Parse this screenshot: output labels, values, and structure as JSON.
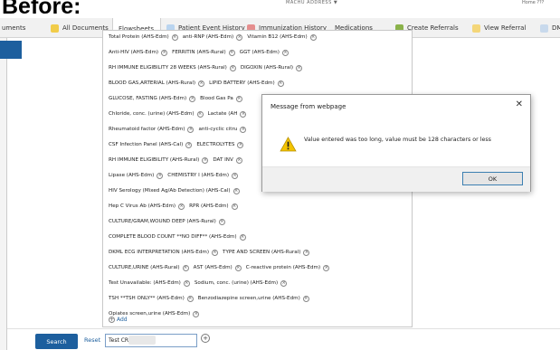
{
  "header": {
    "label": "Before:"
  },
  "topbar": {
    "center_fragment": "MACHU ADDRESS ▼",
    "right_fragment": "Home  ???"
  },
  "tabs": [
    {
      "label": "uments",
      "icon": "none"
    },
    {
      "label": "All Documents",
      "icon": "documents-icon"
    },
    {
      "label": "Flowsheets",
      "icon": "none"
    },
    {
      "label": "Patient Event History",
      "icon": "history-icon"
    },
    {
      "label": "Immunization History",
      "icon": "syringe-icon"
    },
    {
      "label": "Medications",
      "icon": "none"
    },
    {
      "label": "Create Referrals",
      "icon": "referral-icon"
    },
    {
      "label": "View Referral",
      "icon": "view-icon"
    },
    {
      "label": "DM",
      "icon": "dm-icon"
    }
  ],
  "orders": [
    [
      "Total Protein (AHS-Edm)",
      "anti-RNP (AHS-Edm)",
      "Vitamin B12 (AHS-Edm)"
    ],
    [
      "Anti-HIV (AHS-Edm)",
      "FERRITIN (AHS-Rural)",
      "GGT (AHS-Edm)"
    ],
    [
      "RH IMMUNE ELIGIBILITY 28 WEEKS (AHS-Rural)",
      "DIGOXIN (AHS-Rural)"
    ],
    [
      "BLOOD GAS,ARTERIAL (AHS-Rural)",
      "LIPID BATTERY (AHS-Edm)"
    ],
    [
      "GLUCOSE, FASTING (AHS-Edm)",
      "Blood Gas Pa"
    ],
    [
      "Chloride, conc. (urine) (AHS-Edm)",
      "Lactate (AH"
    ],
    [
      "Rheumatoid factor (AHS-Edm)",
      "anti-cyclic citru"
    ],
    [
      "CSF Infection Panel (AHS-Cal)",
      "ELECTROLYTES"
    ],
    [
      "RH IMMUNE ELIGIBILITY (AHS-Rural)",
      "DAT INV"
    ],
    [
      "Lipase (AHS-Edm)",
      "CHEMISTRY I (AHS-Edm)"
    ],
    [
      "HIV Serology (Mixed Ag/Ab Detection) (AHS-Cal)"
    ],
    [
      "Hep C Virus Ab (AHS-Edm)",
      "RPR (AHS-Edm)"
    ],
    [
      "CULTURE/GRAM,WOUND DEEP (AHS-Rural)"
    ],
    [
      "COMPLETE BLOOD COUNT **NO DIFF** (AHS-Edm)"
    ],
    [
      "DKML ECG INTERPRETATION (AHS-Edm)",
      "TYPE AND SCREEN (AHS-Rural)"
    ],
    [
      "CULTURE,URINE (AHS-Rural)",
      "AST (AHS-Edm)",
      "C-reactive protein (AHS-Edm)"
    ],
    [
      "Test Unavailable: (AHS-Edm)",
      "Sodium, conc. (urine) (AHS-Edm)"
    ],
    [
      "TSH **TSH ONLY** (AHS-Edm)",
      "Benzodiazepine screen,urine (AHS-Edm)"
    ],
    [
      "Opiates screen,urine (AHS-Edm)"
    ]
  ],
  "add_label": "Add",
  "bottom": {
    "search_label": "Search",
    "reset_label": "Reset",
    "search_value": "Test CR-4"
  },
  "dialog": {
    "title": "Message from webpage",
    "message": "Value entered was too long, value must be 128 characters or less",
    "ok_label": "OK"
  },
  "colors": {
    "accent": "#1d5f9e",
    "warning": "#f3c300"
  }
}
